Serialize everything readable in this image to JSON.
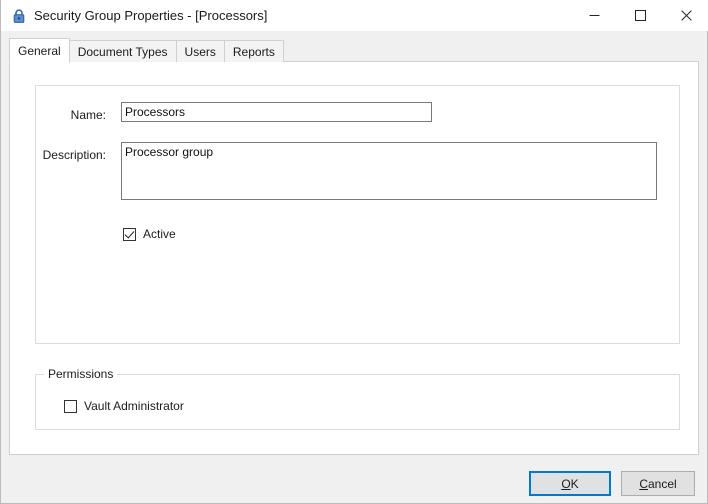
{
  "window": {
    "title": "Security Group Properties - [Processors]",
    "icon": "lock-icon",
    "controls": {
      "minimize": "Minimize",
      "maximize": "Maximize",
      "close": "Close"
    }
  },
  "tabs": [
    {
      "label": "General",
      "selected": true
    },
    {
      "label": "Document Types",
      "selected": false
    },
    {
      "label": "Users",
      "selected": false
    },
    {
      "label": "Reports",
      "selected": false
    }
  ],
  "general": {
    "name": {
      "label": "Name:",
      "value": "Processors",
      "placeholder": ""
    },
    "description": {
      "label": "Description:",
      "value": "Processor group",
      "placeholder": ""
    },
    "active": {
      "label": "Active",
      "checked": true
    }
  },
  "permissions": {
    "legend": "Permissions",
    "items": [
      {
        "label": "Vault Administrator",
        "checked": false
      }
    ]
  },
  "footer": {
    "ok": {
      "accel": "O",
      "rest": "K"
    },
    "cancel": {
      "accel": "C",
      "rest": "ancel"
    }
  },
  "colors": {
    "accent": "#0078d7",
    "window_bg": "#f0f0f0",
    "panel_bg": "#ffffff",
    "border": "#cfcfcf",
    "text": "#1b1b1b",
    "lock_icon": "#4a7ebb"
  }
}
